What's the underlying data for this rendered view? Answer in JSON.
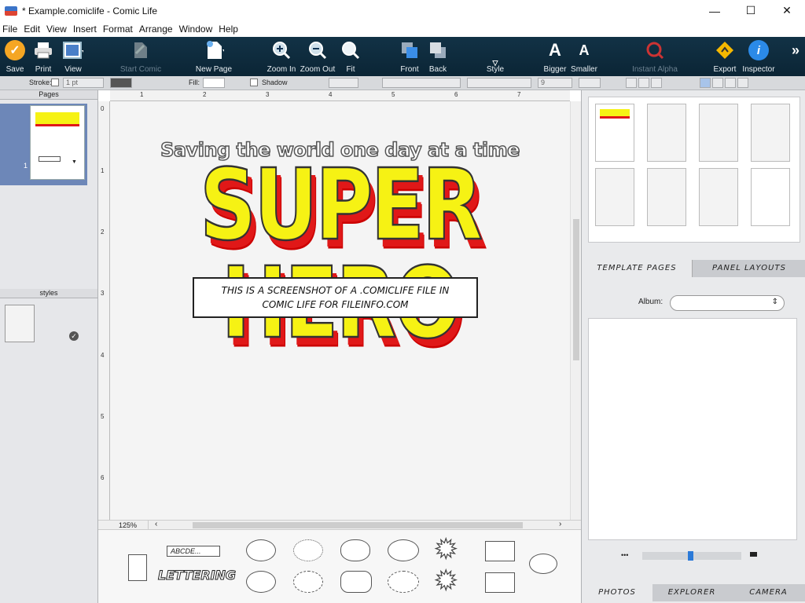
{
  "window": {
    "title": "* Example.comiclife - Comic Life",
    "minimize": "—",
    "maximize": "☐",
    "close": "✕"
  },
  "menu": [
    "File",
    "Edit",
    "View",
    "Insert",
    "Format",
    "Arrange",
    "Window",
    "Help"
  ],
  "toolbar": {
    "save": "Save",
    "print": "Print",
    "view": "View",
    "start_comic": "Start Comic",
    "new_page": "New Page",
    "zoom_in": "Zoom In",
    "zoom_out": "Zoom Out",
    "fit": "Fit",
    "front": "Front",
    "back": "Back",
    "style": "Style",
    "bigger": "Bigger",
    "smaller": "Smaller",
    "instant_alpha": "Instant Alpha",
    "export": "Export",
    "inspector": "Inspector",
    "more": "»"
  },
  "formatbar": {
    "stroke_label": "Stroke:",
    "stroke_width": "1 pt",
    "fill_label": "Fill:",
    "shadow_label": "Shadow",
    "font_size": "9"
  },
  "pages_panel": {
    "header": "Pages",
    "page_number": "1"
  },
  "styles_panel": {
    "header": "styles"
  },
  "ruler": {
    "top": [
      "1",
      "2",
      "3",
      "4",
      "5",
      "6",
      "7"
    ],
    "left": [
      "0",
      "1",
      "2",
      "3",
      "4",
      "5",
      "6"
    ]
  },
  "comic": {
    "tagline": "Saving the world one day at a time",
    "logo": "SUPER HERO",
    "caption_line1": "THIS IS A SCREENSHOT OF A .COMICLIFE FILE IN",
    "caption_line2": "COMIC LIFE FOR FILEINFO.COM"
  },
  "canvas": {
    "zoom": "125%"
  },
  "palette": {
    "lettering_box": "ABCDE...",
    "lettering_art": "LETTERING"
  },
  "right_panel": {
    "tab_template_pages": "TEMPLATE PAGES",
    "tab_panel_layouts": "PANEL LAYOUTS",
    "album_label": "Album:",
    "tab_photos": "PHOTOS",
    "tab_explorer": "EXPLORER",
    "tab_camera": "CAMERA"
  },
  "colors": {
    "toolbar_bg": "#0f2d3f",
    "logo_yellow": "#f6f214",
    "logo_red": "#e01818",
    "selection_blue": "#6d87b8"
  }
}
